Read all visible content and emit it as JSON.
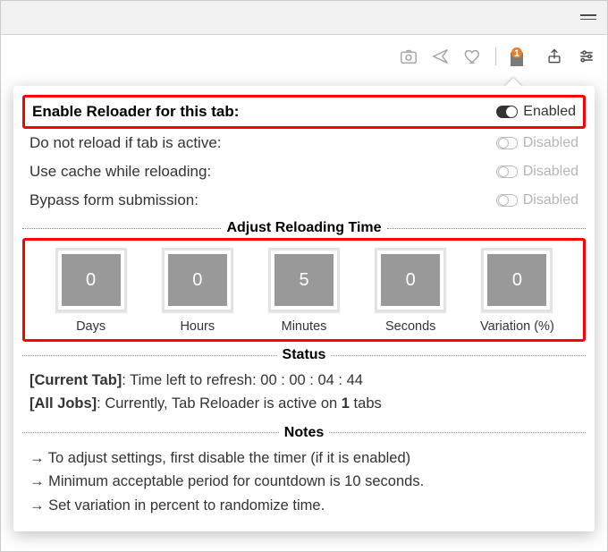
{
  "toolbar": {
    "badge_count": "1"
  },
  "settings": {
    "enable": {
      "label": "Enable Reloader for this tab:",
      "state": "Enabled"
    },
    "no_reload_active": {
      "label": "Do not reload if tab is active:",
      "state": "Disabled"
    },
    "use_cache": {
      "label": "Use cache while reloading:",
      "state": "Disabled"
    },
    "bypass_form": {
      "label": "Bypass form submission:",
      "state": "Disabled"
    }
  },
  "time_section_title": "Adjust Reloading Time",
  "time": [
    {
      "value": "0",
      "label": "Days"
    },
    {
      "value": "0",
      "label": "Hours"
    },
    {
      "value": "5",
      "label": "Minutes"
    },
    {
      "value": "0",
      "label": "Seconds"
    },
    {
      "value": "0",
      "label": "Variation (%)"
    }
  ],
  "status_title": "Status",
  "status": {
    "current_prefix": "[Current Tab]",
    "current_mid": ": Time left to refresh: ",
    "current_time": "00 : 00 : 04 : 44",
    "all_prefix": "[All Jobs]",
    "all_mid_a": ": Currently, Tab Reloader is active on ",
    "all_count": "1",
    "all_mid_b": " tabs"
  },
  "notes_title": "Notes",
  "notes": [
    "To adjust settings, first disable the timer (if it is enabled)",
    "Minimum acceptable period for countdown is 10 seconds.",
    "Set variation in percent to randomize time."
  ]
}
